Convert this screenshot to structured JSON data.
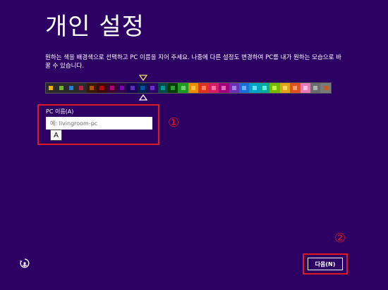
{
  "page": {
    "title": "개인 설정",
    "description": "원하는 색을 배경색으로 선택하고 PC 이름을 지어 주세요. 나중에 다른 설정도 변경하여 PC를 내가 원하는 모습으로 바꿀 수 있습니다.",
    "background_color": "#2d0063"
  },
  "palette": {
    "selected_index": 10,
    "swatches": [
      {
        "bg": "#2b2b2b",
        "chip": "#f0b300"
      },
      {
        "bg": "#2b2b2b",
        "chip": "#73b531"
      },
      {
        "bg": "#2b2b2b",
        "chip": "#2c7ad6"
      },
      {
        "bg": "#2b2b2b",
        "chip": "#bf1e4b"
      },
      {
        "bg": "#3a1a05",
        "chip": "#b54e07"
      },
      {
        "bg": "#3b0a0a",
        "chip": "#c1000e"
      },
      {
        "bg": "#3d0030",
        "chip": "#b40078"
      },
      {
        "bg": "#300050",
        "chip": "#7f00b0"
      },
      {
        "bg": "#1a0055",
        "chip": "#5c2dbe"
      },
      {
        "bg": "#00224a",
        "chip": "#0050b3"
      },
      {
        "bg": "#2d0063",
        "chip": "#6b2fd1"
      },
      {
        "bg": "#004a4a",
        "chip": "#009999"
      },
      {
        "bg": "#003d00",
        "chip": "#2d9f2d"
      },
      {
        "bg": "#1e9b1e",
        "chip": "#6fd16f"
      },
      {
        "bg": "#f08a00",
        "chip": "#ffc04a"
      },
      {
        "bg": "#e0301e",
        "chip": "#ff8060"
      },
      {
        "bg": "#d81b60",
        "chip": "#ff6fa3"
      },
      {
        "bg": "#a0007a",
        "chip": "#e066c0"
      },
      {
        "bg": "#6a2fb5",
        "chip": "#a680e6"
      },
      {
        "bg": "#1a6fd6",
        "chip": "#6ab0ff"
      },
      {
        "bg": "#00a3c4",
        "chip": "#66e0f5"
      },
      {
        "bg": "#00a99d",
        "chip": "#5ef0df"
      },
      {
        "bg": "#78b800",
        "chip": "#c2f04a"
      },
      {
        "bg": "#e3a21a",
        "chip": "#ffd860"
      },
      {
        "bg": "#e05020",
        "chip": "#ff9c6a"
      },
      {
        "bg": "#e978b8",
        "chip": "#ffc0e4"
      },
      {
        "bg": "#6b6b6b",
        "chip": "#b0b0b0"
      },
      {
        "bg": "#7a7a7a",
        "chip": "#c75a1c"
      }
    ]
  },
  "pc_name": {
    "label": "PC 이름(A)",
    "value": "",
    "placeholder": "예: livingroom-pc"
  },
  "ime_indicator": "A",
  "annotations": {
    "one": "①",
    "two": "②",
    "color": "#e0181f"
  },
  "buttons": {
    "next": "다음(N)"
  },
  "icons": {
    "ease_of_access": "ease-of-access-icon",
    "palette_marker_top": "triangle-down-icon",
    "palette_marker_bottom": "triangle-up-icon"
  }
}
